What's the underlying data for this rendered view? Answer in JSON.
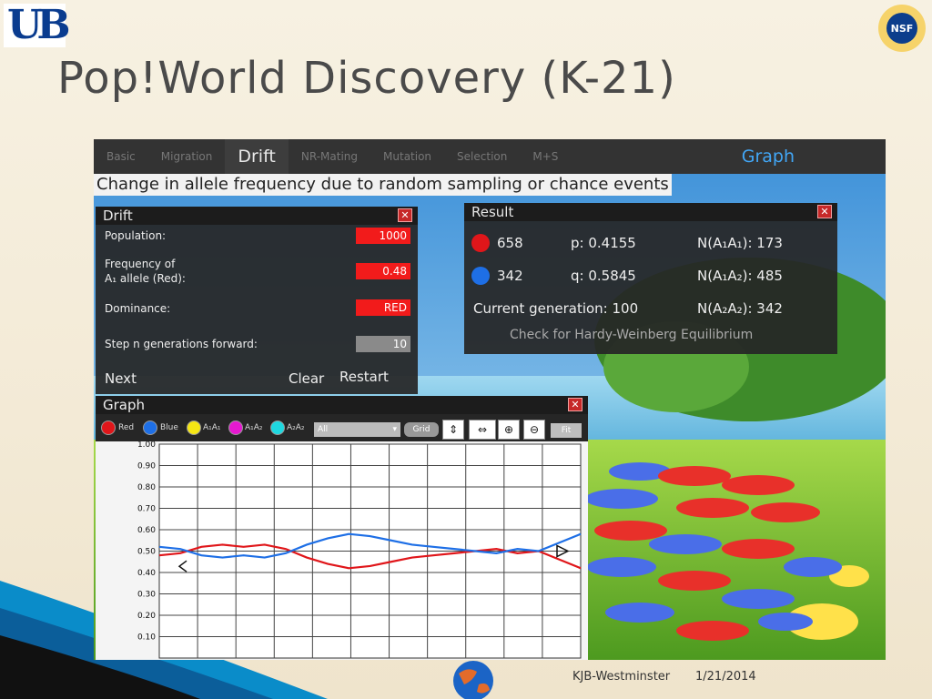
{
  "slide": {
    "title": "Pop!World Discovery (K-21)",
    "logo_left": "UB",
    "logo_right": "NSF",
    "footer_author": "KJB-Westminster",
    "footer_date": "1/21/2014"
  },
  "app": {
    "tabs": [
      "Basic",
      "Migration",
      "Drift",
      "NR-Mating",
      "Mutation",
      "Selection",
      "M+S"
    ],
    "active_tab": "Drift",
    "graph_tab": "Graph",
    "subtitle": "Change in allele frequency due to random sampling or chance events"
  },
  "drift_panel": {
    "title": "Drift",
    "population_label": "Population:",
    "population_value": "1000",
    "frequency_label_1": "Frequency of",
    "frequency_label_2": "A₁ allele (Red):",
    "frequency_value": "0.48",
    "dominance_label": "Dominance:",
    "dominance_value": "RED",
    "step_label": "Step n generations forward:",
    "step_value": "10",
    "next": "Next",
    "clear": "Clear",
    "restart": "Restart"
  },
  "result_panel": {
    "title": "Result",
    "red_count": "658",
    "blue_count": "342",
    "p": "p: 0.4155",
    "q": "q: 0.5845",
    "n_a1a1": "N(A₁A₁): 173",
    "n_a1a2": "N(A₁A₂): 485",
    "n_a2a2": "N(A₂A₂): 342",
    "current_generation": "Current generation:  100",
    "hardy_weinberg": "Check for Hardy-Weinberg Equilibrium"
  },
  "graph_panel": {
    "title": "Graph",
    "legend": [
      "Red",
      "Blue",
      "A₁A₁",
      "A₁A₂",
      "A₂A₂"
    ],
    "legend_colors": [
      "#e0161a",
      "#1e6fe6",
      "#f5e614",
      "#e619d0",
      "#1fd8e0"
    ],
    "select_value": "All",
    "grid_btn": "Grid",
    "fit_btn": "Fit",
    "tool_icons": [
      "vertical-stretch-icon",
      "horizontal-stretch-icon",
      "zoom-in-icon",
      "zoom-out-icon"
    ]
  },
  "chart_data": {
    "type": "line",
    "ylim": [
      0,
      1.0
    ],
    "y_ticks": [
      "1.00",
      "0.90",
      "0.80",
      "0.70",
      "0.60",
      "0.50",
      "0.40",
      "0.30",
      "0.20",
      "0.10"
    ],
    "x": [
      0,
      5,
      10,
      15,
      20,
      25,
      30,
      35,
      40,
      45,
      50,
      55,
      60,
      65,
      70,
      75,
      80,
      85,
      90,
      95,
      100
    ],
    "series": [
      {
        "color": "#e0161a",
        "values": [
          0.48,
          0.49,
          0.52,
          0.53,
          0.52,
          0.53,
          0.51,
          0.47,
          0.44,
          0.42,
          0.43,
          0.45,
          0.47,
          0.48,
          0.49,
          0.5,
          0.51,
          0.49,
          0.5,
          0.46,
          0.42
        ]
      },
      {
        "color": "#1e6fe6",
        "values": [
          0.52,
          0.51,
          0.48,
          0.47,
          0.48,
          0.47,
          0.49,
          0.53,
          0.56,
          0.58,
          0.57,
          0.55,
          0.53,
          0.52,
          0.51,
          0.5,
          0.49,
          0.51,
          0.5,
          0.54,
          0.58
        ]
      }
    ]
  }
}
